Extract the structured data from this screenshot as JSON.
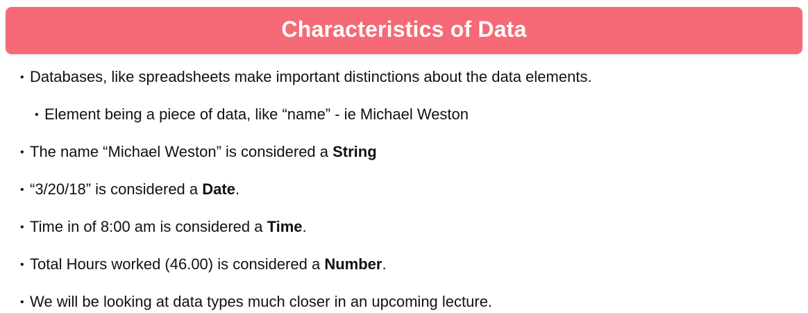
{
  "slide": {
    "title": "Characteristics of Data",
    "title_bar_color": "#f56a76",
    "bullet_symbol": "•",
    "bullets": [
      {
        "text": "Databases, like spreadsheets make important distinctions about the data elements.",
        "level": 1
      },
      {
        "text": "Element being a piece of data, like “name” - ie Michael Weston",
        "level": 2
      },
      {
        "text": "The name “Michael Weston” is considered a ",
        "emphasis": "String",
        "suffix": "",
        "level": 1
      },
      {
        "text": "“3/20/18” is considered a ",
        "emphasis": "Date",
        "suffix": ".",
        "level": 1
      },
      {
        "text": "Time in of 8:00 am is considered a ",
        "emphasis": "Time",
        "suffix": ".",
        "level": 1
      },
      {
        "text": "Total Hours worked (46.00) is considered a ",
        "emphasis": "Number",
        "suffix": ".",
        "level": 1
      },
      {
        "text": "We will be looking at data types much closer in an upcoming lecture.",
        "level": 1
      }
    ]
  }
}
